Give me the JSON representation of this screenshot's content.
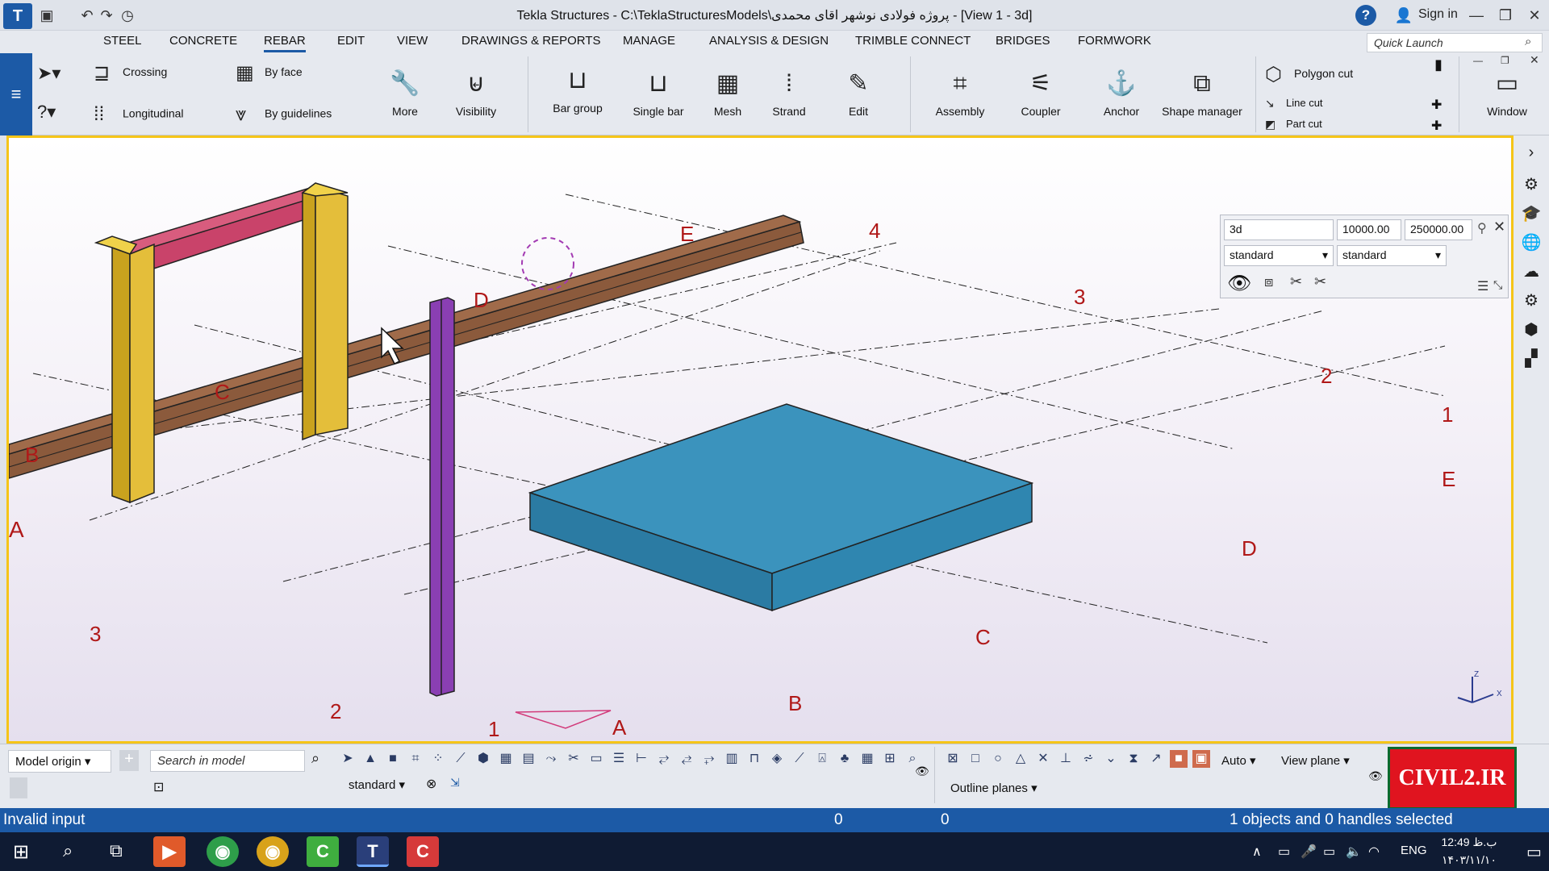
{
  "window": {
    "title": "Tekla Structures - C:\\TeklaStructuresModels\\پروژه فولادی نوشهر اقای محمدی - [View 1 - 3d]",
    "sign_in": "Sign in",
    "help": "?"
  },
  "menu": {
    "items": [
      "STEEL",
      "CONCRETE",
      "REBAR",
      "EDIT",
      "VIEW",
      "DRAWINGS & REPORTS",
      "MANAGE",
      "ANALYSIS & DESIGN",
      "TRIMBLE CONNECT",
      "BRIDGES",
      "FORMWORK"
    ],
    "active": "REBAR",
    "quick_launch_placeholder": "Quick Launch"
  },
  "ribbon": {
    "crossing": "Crossing",
    "longitudinal": "Longitudinal",
    "by_face": "By face",
    "by_guidelines": "By guidelines",
    "more": "More",
    "visibility": "Visibility",
    "bar_group": "Bar group",
    "single_bar": "Single bar",
    "mesh": "Mesh",
    "strand": "Strand",
    "edit": "Edit",
    "assembly": "Assembly",
    "coupler": "Coupler",
    "anchor": "Anchor",
    "shape_manager": "Shape manager",
    "polygon_cut": "Polygon cut",
    "line_cut": "Line cut",
    "part_cut": "Part cut",
    "window": "Window"
  },
  "view_properties": {
    "view_name": "3d",
    "depth_down": "10000.00",
    "depth_up": "250000.00",
    "setting_left": "standard",
    "setting_right": "standard"
  },
  "grid_labels": {
    "letters_left": [
      "A",
      "B",
      "C",
      "D",
      "E"
    ],
    "letters_right": [
      "E",
      "D",
      "C",
      "B",
      "A"
    ],
    "numbers_top": [
      "4",
      "3",
      "2",
      "1"
    ],
    "numbers_bottom": [
      "3",
      "2",
      "1"
    ]
  },
  "bottom": {
    "model_origin": "Model origin",
    "search_placeholder": "Search in model",
    "standard": "standard",
    "auto": "Auto",
    "view_plane": "View plane",
    "outline_planes": "Outline planes"
  },
  "status": {
    "message": "Invalid input",
    "coord1": "0",
    "coord2": "0",
    "selection": "1 objects and 0 handles selected"
  },
  "taskbar": {
    "time": "12:49 ب.ظ",
    "date": "۱۴۰۳/۱۱/۱۰",
    "lang": "ENG"
  },
  "watermark": "CIVIL2.IR",
  "axis": {
    "x": "X",
    "z": "Z"
  }
}
